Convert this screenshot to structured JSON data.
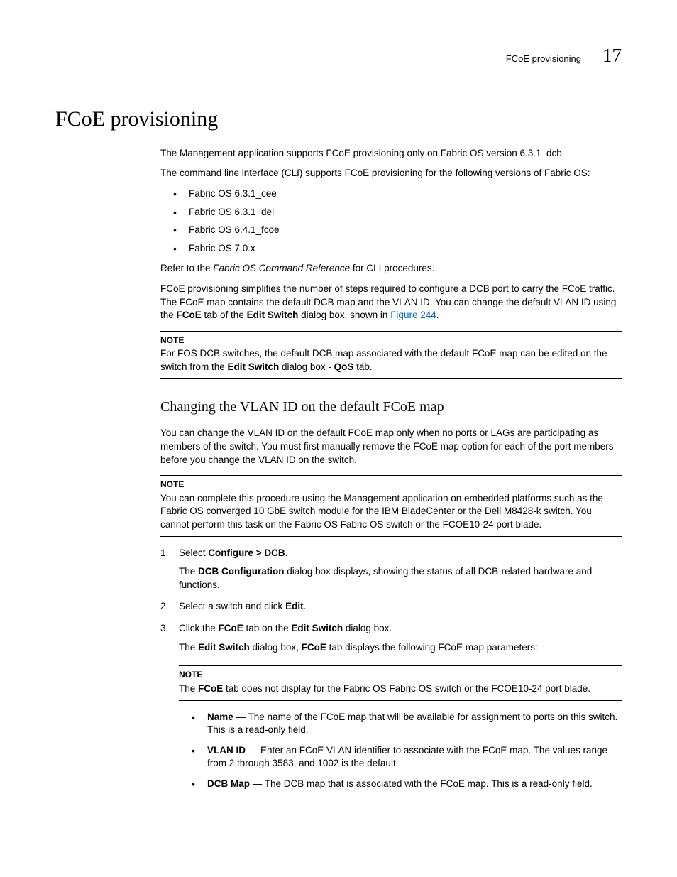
{
  "header": {
    "section": "FCoE provisioning",
    "chapter": "17"
  },
  "h1": "FCoE provisioning",
  "p1": "The Management application supports FCoE provisioning only on Fabric OS version 6.3.1_dcb.",
  "p2": "The command line interface (CLI) supports FCoE provisioning for the following versions of Fabric OS:",
  "os_list": [
    "Fabric OS 6.3.1_cee",
    "Fabric OS 6.3.1_del",
    "Fabric OS 6.4.1_fcoe",
    "Fabric OS 7.0.x"
  ],
  "p3_a": "Refer to the ",
  "p3_i": "Fabric OS Command Reference",
  "p3_b": " for CLI procedures.",
  "p4_a": "FCoE provisioning simplifies the number of steps required to configure a DCB port to carry the FCoE traffic. The FCoE map contains the default DCB map and the VLAN ID. You can change the default VLAN ID using the ",
  "p4_b1": "FCoE",
  "p4_c": " tab of the ",
  "p4_b2": "Edit Switch",
  "p4_d": " dialog box, shown in ",
  "p4_link": "Figure 244",
  "p4_e": ".",
  "note1": {
    "label": "NOTE",
    "a": "For FOS DCB switches, the default DCB map associated with the default FCoE map can be edited on the switch from the ",
    "b1": "Edit Switch",
    "c": " dialog box - ",
    "b2": "QoS",
    "d": " tab."
  },
  "h2": "Changing the VLAN ID on the default FCoE map",
  "p5": "You can change the VLAN ID on the default FCoE map only when no ports or LAGs are participating as members of the switch. You must first manually remove the FCoE map option for each of the port members before you change the VLAN ID on the switch.",
  "note2": {
    "label": "NOTE",
    "text": "You can complete this procedure using the Management application on embedded platforms such as the Fabric OS converged 10 GbE switch module for the IBM BladeCenter or the Dell M8428-k switch. You cannot perform this task on the Fabric OS Fabric OS switch or the FCOE10-24 port blade."
  },
  "steps": {
    "s1_a": "Select ",
    "s1_b": "Configure > DCB",
    "s1_c": ".",
    "s1_sub_a": "The ",
    "s1_sub_b": "DCB Configuration",
    "s1_sub_c": " dialog box displays, showing the status of all DCB-related hardware and functions.",
    "s2_a": "Select a switch and click ",
    "s2_b": "Edit",
    "s2_c": ".",
    "s3_a": "Click the ",
    "s3_b1": "FCoE",
    "s3_c": " tab on the ",
    "s3_b2": "Edit Switch",
    "s3_d": " dialog box.",
    "s3_sub_a": "The ",
    "s3_sub_b1": "Edit Switch",
    "s3_sub_c": " dialog box, ",
    "s3_sub_b2": "FCoE",
    "s3_sub_d": " tab displays the following FCoE map parameters:"
  },
  "note3": {
    "label": "NOTE",
    "a": "The ",
    "b": "FCoE",
    "c": " tab does not display for the Fabric OS Fabric OS switch or the FCOE10-24 port blade."
  },
  "params": {
    "i1_b": "Name",
    "i1_t": " — The name of the FCoE map that will be available for assignment to ports on this switch. This is a read-only field.",
    "i2_b": "VLAN ID",
    "i2_t": " — Enter an FCoE VLAN identifier to associate with the FCoE map. The values range from 2 through 3583, and 1002 is the default.",
    "i3_b": "DCB Map",
    "i3_t": " — The DCB map that is associated with the FCoE map. This is a read-only field."
  }
}
